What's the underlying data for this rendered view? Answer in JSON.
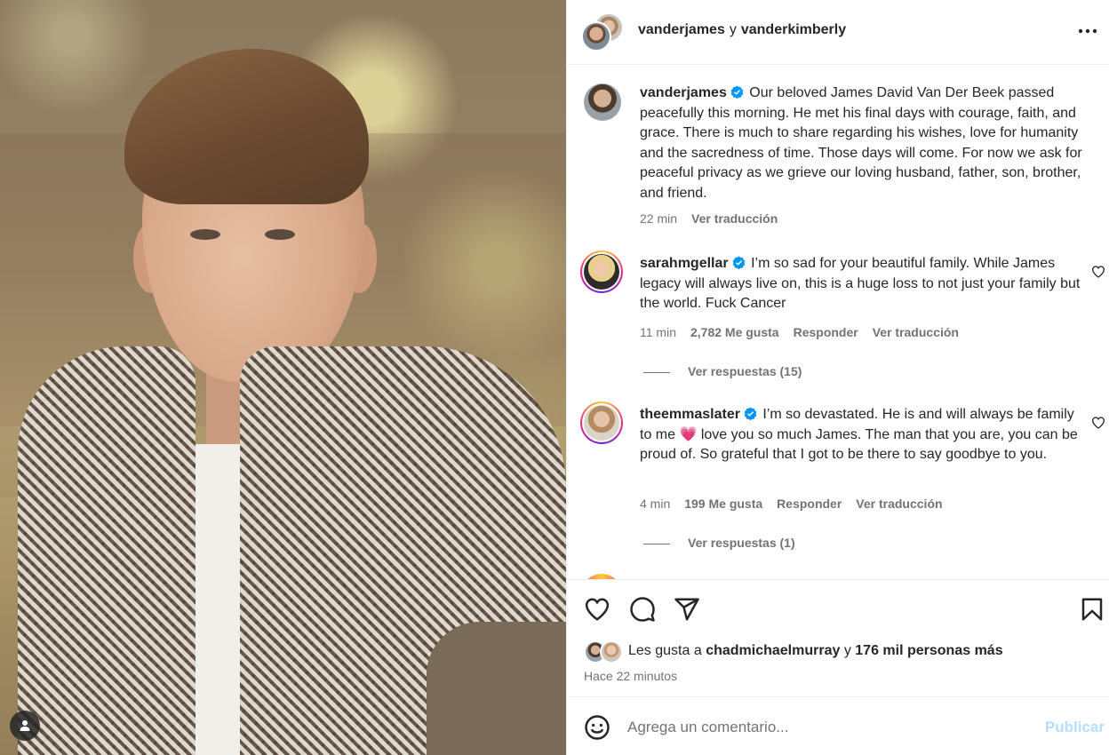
{
  "post": {
    "header": {
      "user1": "vanderjames",
      "conjunction": "y",
      "user2": "vanderkimberly",
      "more_icon": "more-horizontal-icon"
    },
    "caption": {
      "username": "vanderjames",
      "text": "Our beloved James David Van Der Beek passed peacefully this morning. He met his final days with courage, faith, and grace. There is much to share regarding his wishes, love for humanity and the sacredness of time. Those days will come. For now we ask for peaceful privacy as we grieve our loving husband, father, son, brother, and friend.",
      "time": "22 min",
      "translate": "Ver traducción"
    },
    "comments": [
      {
        "username": "sarahmgellar",
        "text": "I’m so sad for your beautiful family. While James legacy will always live on, this is a huge loss to not just your family but the world. Fuck Cancer",
        "time": "11 min",
        "likes": "2,782 Me gusta",
        "reply": "Responder",
        "translate": "Ver traducción",
        "replies_label": "Ver respuestas (15)"
      },
      {
        "username": "theemmaslater",
        "text_before": "I’m so devastated. He is and will always be family to me",
        "emoji": "💗",
        "text_after": "love you so much James. The man that you are, you can be proud of. So grateful that I got to be there to say goodbye to you.",
        "time": "4 min",
        "likes": "199 Me gusta",
        "reply": "Responder",
        "translate": "Ver traducción",
        "replies_label": "Ver respuestas (1)"
      }
    ],
    "actions": {
      "icons": [
        "heart-icon",
        "comment-icon",
        "share-icon",
        "bookmark-icon"
      ]
    },
    "likes": {
      "prefix": "Les gusta a",
      "user": "chadmichaelmurray",
      "conjunction": "y",
      "others": "176 mil personas más"
    },
    "time_ago": "Hace 22 minutos",
    "add_comment": {
      "placeholder": "Agrega un comentario...",
      "publish": "Publicar"
    }
  },
  "colors": {
    "text": "#262626",
    "secondary": "#737373",
    "verified": "#0095f6",
    "publish_disabled": "#b2dffc"
  }
}
